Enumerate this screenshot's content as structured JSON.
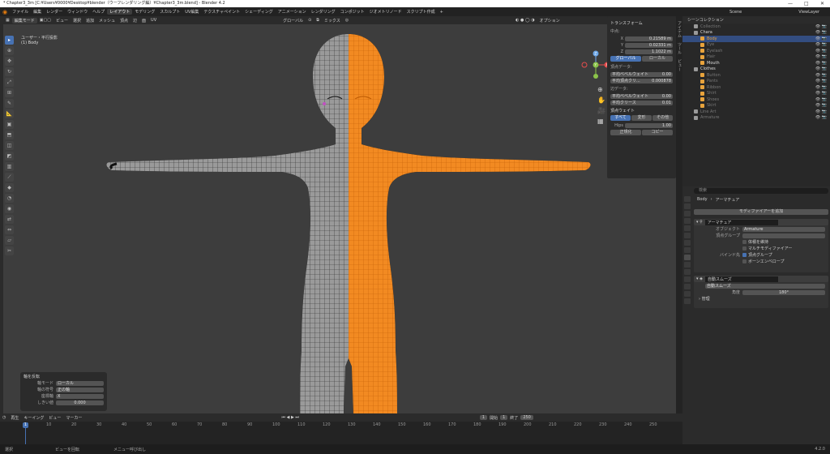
{
  "window": {
    "title": "* Chapter3_3m [C:¥Users¥0000¥Desktop¥blender（ウーフレンダリング編）¥Chapter3_3m.blend] - Blender 4.2",
    "controls": [
      "—",
      "□",
      "✕"
    ]
  },
  "menu": {
    "items": [
      "ファイル",
      "編集",
      "レンダー",
      "ウィンドウ",
      "ヘルプ"
    ],
    "workspaces": [
      "レイアウト",
      "モデリング",
      "スカルプト",
      "UV編集",
      "テクスチャペイント",
      "シェーディング",
      "アニメーション",
      "レンダリング",
      "コンポジット",
      "ジオメトリノード",
      "スクリプト作成",
      "+"
    ],
    "active_workspace": "レイアウト"
  },
  "topright": {
    "scene": "Scene",
    "viewlayer": "ViewLayer"
  },
  "viewport": {
    "header": {
      "mode": "編集モード",
      "menus": [
        "ビュー",
        "選択",
        "追加",
        "メッシュ",
        "頂点",
        "辺",
        "面",
        "UV"
      ],
      "orientation": "グローバル",
      "snap": "ミックス",
      "options": "オプション"
    },
    "overlay_line1": "ユーザー・平行投影",
    "overlay_line2": "(1) Body",
    "gizmo": {
      "x": "X",
      "y": "Y",
      "z": "Z"
    },
    "colors": {
      "mesh_selected": "#ff8c1a",
      "mesh_unselected": "#9a9a9a",
      "wire": "#222222"
    }
  },
  "npanel": {
    "transform_header": "トランスフォーム",
    "median": "中点:",
    "x_label": "X",
    "x_value": "0.21589 m",
    "y_label": "Y",
    "y_value": "0.02331 m",
    "z_label": "Z",
    "z_value": "1.1022 m",
    "global": "グローバル",
    "local": "ローカル",
    "vertex_data": "頂点データ:",
    "mean_bevel_weight": "平均ベベルウェイト",
    "mean_bevel_value": "0.00",
    "mean_vertex_crease": "平均頂点クリ...",
    "mean_vertex_crease_value": "0.000878",
    "edge_data": "辺データ:",
    "edge_bevel": "平均ベベルウェイト",
    "edge_bevel_value": "0.00",
    "edge_crease": "平均クリース",
    "edge_crease_value": "0.01",
    "vertex_weight_header": "頂点ウェイト",
    "all": "すべて",
    "deform": "変形",
    "other": "その他",
    "hips": "Hips",
    "hips_value": "1.00",
    "normalize": "正規化",
    "copy": "コピー",
    "tabs": [
      "アイテム",
      "ツール",
      "ビュー"
    ]
  },
  "op_panel": {
    "title": "軸を反転",
    "axis_mode_label": "軸モード",
    "axis_mode": "ローカル",
    "axis_sign_label": "軸の符号",
    "axis_sign": "正の軸",
    "axis_label": "座標軸",
    "axis": "X",
    "threshold_label": "しきい値",
    "threshold": "0.000"
  },
  "timeline": {
    "menus": [
      "再生",
      "キーイング",
      "ビュー",
      "マーカー"
    ],
    "current_frame": "1",
    "start_label": "開始",
    "start": "1",
    "end_label": "終了",
    "end": "250",
    "ticks": [
      "10",
      "20",
      "30",
      "40",
      "50",
      "60",
      "70",
      "80",
      "90",
      "100",
      "110",
      "120",
      "130",
      "140",
      "150",
      "160",
      "170",
      "180",
      "190",
      "200",
      "210",
      "220",
      "230",
      "240",
      "250"
    ]
  },
  "status": {
    "select": "選択",
    "rotate": "ビューを回転",
    "menu": "メニュー呼び出し",
    "version": "4.2.0"
  },
  "outliner": {
    "header": "シーンコレクション",
    "rows": [
      {
        "label": "Collection",
        "indent": 1,
        "color": "#777777"
      },
      {
        "label": "Chara",
        "indent": 1,
        "color": "#dddddd"
      },
      {
        "label": "Body",
        "indent": 2,
        "color": "#e8a33c"
      },
      {
        "label": "Eye",
        "indent": 2,
        "color": "#777777"
      },
      {
        "label": "Eyelash",
        "indent": 2,
        "color": "#777777"
      },
      {
        "label": "Hair",
        "indent": 2,
        "color": "#777777"
      },
      {
        "label": "Mouth",
        "indent": 2,
        "color": "#dddddd"
      },
      {
        "label": "Clothes",
        "indent": 1,
        "color": "#dddddd"
      },
      {
        "label": "Button",
        "indent": 2,
        "color": "#777777"
      },
      {
        "label": "Pants",
        "indent": 2,
        "color": "#777777"
      },
      {
        "label": "Ribbon",
        "indent": 2,
        "color": "#777777"
      },
      {
        "label": "Shirt",
        "indent": 2,
        "color": "#777777"
      },
      {
        "label": "Shoes",
        "indent": 2,
        "color": "#777777"
      },
      {
        "label": "Skirt",
        "indent": 2,
        "color": "#777777"
      },
      {
        "label": "Line Art",
        "indent": 1,
        "color": "#777777"
      },
      {
        "label": "Armature",
        "indent": 1,
        "color": "#777777"
      }
    ]
  },
  "properties": {
    "search_placeholder": "検索",
    "breadcrumb_obj": "Body",
    "breadcrumb_mod": "アーマチュア",
    "add_modifier": "モディファイアーを追加",
    "armature_mod": {
      "name": "アーマチュア",
      "object_label": "オブジェクト",
      "object": "Armature",
      "vertex_group_label": "頂点グループ",
      "preserve_volume": "体積を維持",
      "multi_modifier": "マルチモディファイアー",
      "bind_label": "バインド先",
      "vertex_groups": "頂点グループ",
      "bone_envelopes": "ボーンエンベロープ"
    },
    "smooth_mod": {
      "name": "自動スムーズ",
      "node_group": "自動スムーズ",
      "angle_label": "角度",
      "angle": "180°",
      "manage": "管理"
    }
  }
}
